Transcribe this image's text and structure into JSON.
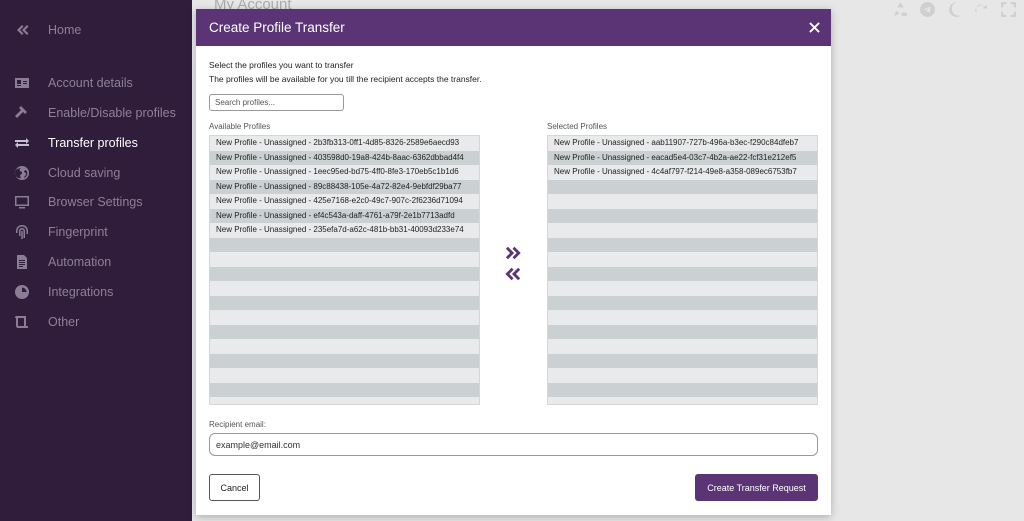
{
  "sidebar": {
    "home_label": "Home",
    "items": [
      {
        "label": "Account details",
        "icon": "id-card-icon"
      },
      {
        "label": "Enable/Disable profiles",
        "icon": "hammer-icon"
      },
      {
        "label": "Transfer profiles",
        "icon": "transfer-arrows-icon",
        "active": true
      },
      {
        "label": "Cloud saving",
        "icon": "globe-icon"
      },
      {
        "label": "Browser Settings",
        "icon": "monitor-icon"
      },
      {
        "label": "Fingerprint",
        "icon": "fingerprint-icon"
      },
      {
        "label": "Automation",
        "icon": "document-icon"
      },
      {
        "label": "Integrations",
        "icon": "pie-icon"
      },
      {
        "label": "Other",
        "icon": "scroll-icon"
      }
    ]
  },
  "background": {
    "title": "My Account",
    "top_icons": [
      "recycle-icon",
      "telegram-icon",
      "moon-icon",
      "refresh-icon",
      "expand-icon"
    ]
  },
  "modal": {
    "title": "Create Profile Transfer",
    "intro_line1": "Select the profiles you want to transfer",
    "intro_line2": "The profiles will be available for you till the recipient accepts the transfer.",
    "search_placeholder": "Search profiles...",
    "available_label": "Available Profiles",
    "selected_label": "Selected Profiles",
    "available_profiles": [
      "New Profile - Unassigned - 2b3fb313-0ff1-4d85-8326-2589e6aecd93",
      "New Profile - Unassigned - 403598d0-19a8-424b-8aac-6362dbbad4f4",
      "New Profile - Unassigned - 1eec95ed-bd75-4ff0-8fe3-170eb5c1b1d6",
      "New Profile - Unassigned - 89c88438-105e-4a72-82e4-9ebfdf29ba77",
      "New Profile - Unassigned - 425e7168-e2c0-49c7-907c-2f6236d71094",
      "New Profile - Unassigned - ef4c543a-daff-4761-a79f-2e1b7713adfd",
      "New Profile - Unassigned - 235efa7d-a62c-481b-bb31-40093d233e74"
    ],
    "selected_profiles": [
      "New Profile - Unassigned - aab11907-727b-496a-b3ec-f290c84dfeb7",
      "New Profile - Unassigned - eacad5e4-03c7-4b2a-ae22-fcf31e212ef5",
      "New Profile - Unassigned - 4c4af797-f214-49e8-a358-089ec6753fb7"
    ],
    "recipient_label": "Recipient email:",
    "email_placeholder": "example@email.com",
    "cancel_label": "Cancel",
    "create_label": "Create Transfer Request"
  },
  "colors": {
    "accent": "#5a3474",
    "sidebar_bg": "#2f1d3b"
  }
}
